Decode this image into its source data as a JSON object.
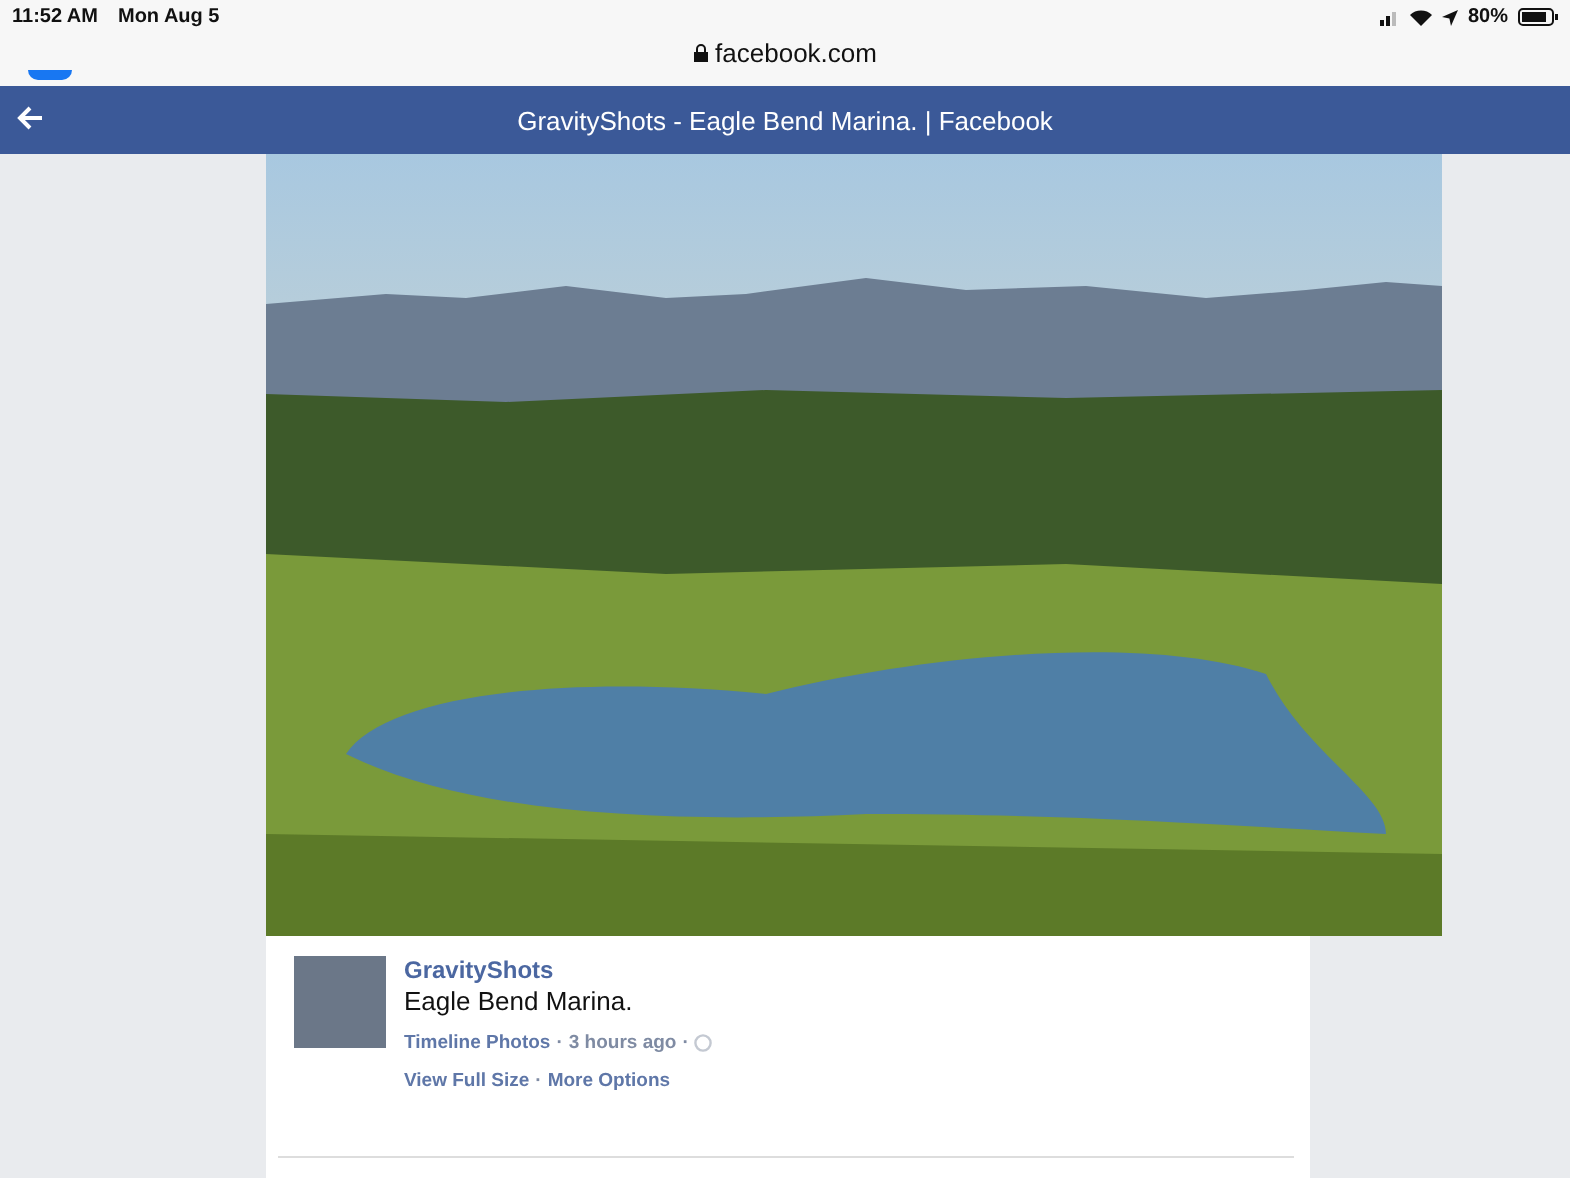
{
  "status_bar": {
    "time": "11:52 AM",
    "date": "Mon Aug 5",
    "battery": "80%"
  },
  "address_bar": {
    "url": "facebook.com"
  },
  "header": {
    "title": "GravityShots - Eagle Bend Marina. | Facebook"
  },
  "post": {
    "author": "GravityShots",
    "caption": "Eagle Bend Marina.",
    "separator": "·",
    "album": "Timeline Photos",
    "time": "3 hours ago",
    "actions": [
      "View Full Size",
      "More Options"
    ]
  }
}
